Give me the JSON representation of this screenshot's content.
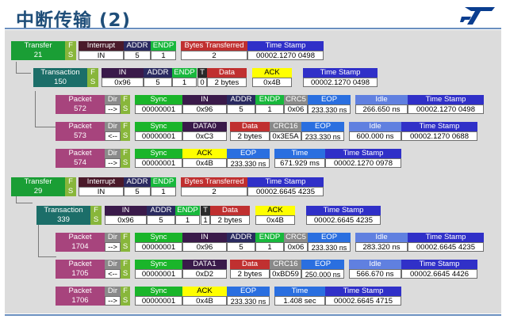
{
  "title": "中断传输 (2)",
  "headers": {
    "transfer": "Transfer",
    "transaction": "Transaction",
    "packet": "Packet",
    "f": "F",
    "s": "S",
    "dir": "Dir",
    "sync": "Sync",
    "interrupt": "Interrupt",
    "addr": "ADDR",
    "endp": "ENDP",
    "bytes_transferred": "Bytes Transferred",
    "time_stamp": "Time Stamp",
    "in": "IN",
    "t": "T",
    "data": "Data",
    "ack": "ACK",
    "crc5": "CRC5",
    "crc16": "CRC16",
    "eop": "EOP",
    "idle": "Idle",
    "time": "Time"
  },
  "transfers": [
    {
      "num": "21",
      "s": "S",
      "interrupt": "IN",
      "addr": "5",
      "endp": "1",
      "bytes": "2",
      "ts": "00002.1270 0498",
      "transaction": {
        "num": "150",
        "s": "S",
        "in": "0x96",
        "addr": "5",
        "endp": "1",
        "t": "0",
        "data": "2 bytes",
        "ack": "0x4B",
        "ts": "00002.1270 0498"
      },
      "packets": [
        {
          "num": "572",
          "dir": "-->",
          "s": "S",
          "sync": "00000001",
          "pid_label": "IN",
          "pid": "0x96",
          "addr": "5",
          "endp": "1",
          "crc": "0x06",
          "eop": "233.330 ns",
          "idle": "266.650 ns",
          "ts": "00002.1270 0498"
        },
        {
          "num": "573",
          "dir": "<--",
          "s": "S",
          "sync": "00000001",
          "pid_label": "DATA0",
          "pid": "0xC3",
          "data": "2 bytes",
          "crc": "0x3E5A",
          "eop": "233.330 ns",
          "idle": "600.000 ns",
          "ts": "00002.1270 0688"
        },
        {
          "num": "574",
          "dir": "-->",
          "s": "S",
          "sync": "00000001",
          "pid_label": "ACK",
          "pid": "0x4B",
          "eop": "233.330 ns",
          "time": "671.929 ms",
          "ts": "00002.1270 0978"
        }
      ]
    },
    {
      "num": "29",
      "s": "S",
      "interrupt": "IN",
      "addr": "5",
      "endp": "1",
      "bytes": "2",
      "ts": "00002.6645 4235",
      "transaction": {
        "num": "339",
        "s": "S",
        "in": "0x96",
        "addr": "5",
        "endp": "1",
        "t": "1",
        "data": "2 bytes",
        "ack": "0x4B",
        "ts": "00002.6645 4235"
      },
      "packets": [
        {
          "num": "1704",
          "dir": "-->",
          "s": "S",
          "sync": "00000001",
          "pid_label": "IN",
          "pid": "0x96",
          "addr": "5",
          "endp": "1",
          "crc": "0x06",
          "eop": "233.330 ns",
          "idle": "283.320 ns",
          "ts": "00002.6645 4235"
        },
        {
          "num": "1705",
          "dir": "<--",
          "s": "S",
          "sync": "00000001",
          "pid_label": "DATA1",
          "pid": "0xD2",
          "data": "2 bytes",
          "crc": "0xBD59",
          "eop": "250.000 ns",
          "idle": "566.670 ns",
          "ts": "00002.6645 4426"
        },
        {
          "num": "1706",
          "dir": "-->",
          "s": "S",
          "sync": "00000001",
          "pid_label": "ACK",
          "pid": "0x4B",
          "eop": "233.330 ns",
          "time": "1.408 sec",
          "ts": "00002.6645 4715"
        }
      ]
    }
  ]
}
